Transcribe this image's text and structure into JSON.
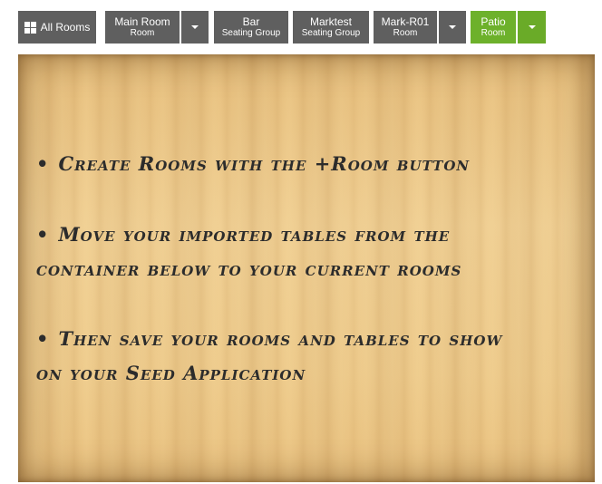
{
  "toolbar": {
    "all_rooms": {
      "label": "All Rooms",
      "icon": "grid-icon"
    },
    "rooms": [
      {
        "name": "Main Room",
        "type": "Room"
      },
      {
        "name": "Bar",
        "type": "Seating Group"
      },
      {
        "name": "Marktest",
        "type": "Seating Group"
      },
      {
        "name": "Mark-R01",
        "type": "Room"
      },
      {
        "name": "Patio",
        "type": "Room"
      }
    ],
    "active_room": "Patio",
    "colors": {
      "button": "#5f5f5f",
      "active": "#6db12b"
    }
  },
  "board": {
    "instructions": [
      "Create Rooms with the +Room button",
      "Move your imported tables from the container below to your current rooms",
      "Then save your rooms and tables to show on your Seed Application"
    ]
  }
}
